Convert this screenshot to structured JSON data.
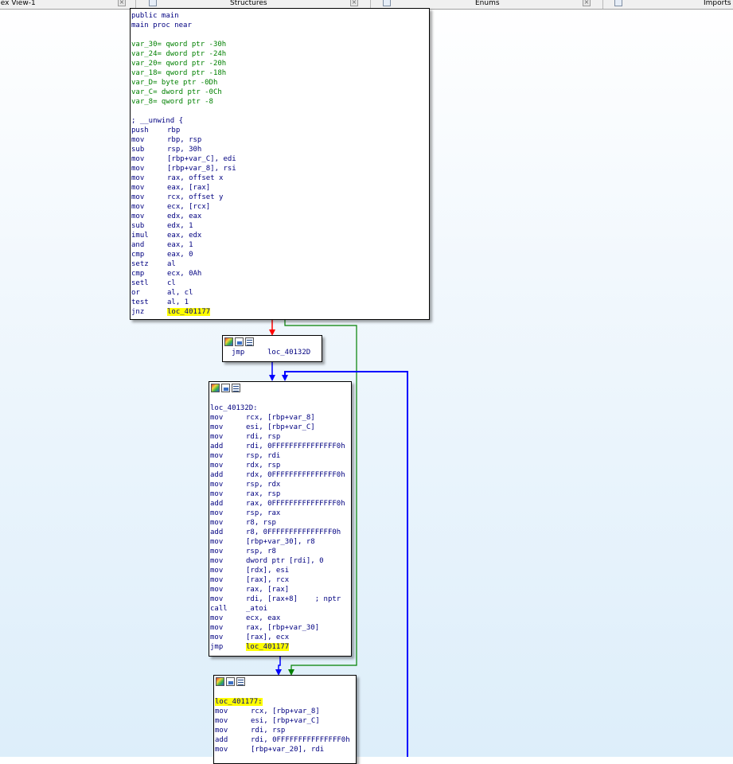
{
  "tabs": [
    {
      "label": "Hex View-1"
    },
    {
      "label": "Structures"
    },
    {
      "label": "Enums"
    },
    {
      "label": "Imports"
    }
  ],
  "colors": {
    "edge_true": "#008000",
    "edge_false": "#ff0000",
    "edge_uncond": "#0000ff",
    "highlight": "#ffff00"
  },
  "header_icons": [
    "graph-overview-icon",
    "edit-node-icon",
    "node-menu-icon"
  ],
  "node_main": {
    "lines": [
      {
        "t": "public main"
      },
      {
        "t": "main proc near"
      },
      {
        "t": ""
      },
      {
        "t": "var_30= qword ptr -30h",
        "c": "var"
      },
      {
        "t": "var_24= dword ptr -24h",
        "c": "var"
      },
      {
        "t": "var_20= qword ptr -20h",
        "c": "var"
      },
      {
        "t": "var_18= qword ptr -18h",
        "c": "var"
      },
      {
        "t": "var_D= byte ptr -0Dh",
        "c": "var"
      },
      {
        "t": "var_C= dword ptr -0Ch",
        "c": "var"
      },
      {
        "t": "var_8= qword ptr -8",
        "c": "var"
      },
      {
        "t": ""
      },
      {
        "t": "; __unwind {"
      },
      {
        "m": "push",
        "o": "rbp"
      },
      {
        "m": "mov",
        "o": "rbp, rsp"
      },
      {
        "m": "sub",
        "o": "rsp, 30h"
      },
      {
        "m": "mov",
        "o": "[rbp+var_C], edi"
      },
      {
        "m": "mov",
        "o": "[rbp+var_8], rsi"
      },
      {
        "m": "mov",
        "o": "rax, offset x"
      },
      {
        "m": "mov",
        "o": "eax, [rax]"
      },
      {
        "m": "mov",
        "o": "rcx, offset y"
      },
      {
        "m": "mov",
        "o": "ecx, [rcx]"
      },
      {
        "m": "mov",
        "o": "edx, eax"
      },
      {
        "m": "sub",
        "o": "edx, 1"
      },
      {
        "m": "imul",
        "o": "eax, edx"
      },
      {
        "m": "and",
        "o": "eax, 1"
      },
      {
        "m": "cmp",
        "o": "eax, 0"
      },
      {
        "m": "setz",
        "o": "al"
      },
      {
        "m": "cmp",
        "o": "ecx, 0Ah"
      },
      {
        "m": "setl",
        "o": "cl"
      },
      {
        "m": "or",
        "o": "al, cl"
      },
      {
        "m": "test",
        "o": "al, 1"
      },
      {
        "m": "jnz",
        "o": "loc_401177",
        "hl": true
      }
    ]
  },
  "node_jmp": {
    "lines": [
      {
        "m": "jmp",
        "o": "loc_40132D"
      }
    ]
  },
  "node_40132D": {
    "lines": [
      {
        "t": ""
      },
      {
        "t": "loc_40132D:"
      },
      {
        "m": "mov",
        "o": "rcx, [rbp+var_8]"
      },
      {
        "m": "mov",
        "o": "esi, [rbp+var_C]"
      },
      {
        "m": "mov",
        "o": "rdi, rsp"
      },
      {
        "m": "add",
        "o": "rdi, 0FFFFFFFFFFFFFFF0h"
      },
      {
        "m": "mov",
        "o": "rsp, rdi"
      },
      {
        "m": "mov",
        "o": "rdx, rsp"
      },
      {
        "m": "add",
        "o": "rdx, 0FFFFFFFFFFFFFFF0h"
      },
      {
        "m": "mov",
        "o": "rsp, rdx"
      },
      {
        "m": "mov",
        "o": "rax, rsp"
      },
      {
        "m": "add",
        "o": "rax, 0FFFFFFFFFFFFFFF0h"
      },
      {
        "m": "mov",
        "o": "rsp, rax"
      },
      {
        "m": "mov",
        "o": "r8, rsp"
      },
      {
        "m": "add",
        "o": "r8, 0FFFFFFFFFFFFFFF0h"
      },
      {
        "m": "mov",
        "o": "[rbp+var_30], r8"
      },
      {
        "m": "mov",
        "o": "rsp, r8"
      },
      {
        "m": "mov",
        "o": "dword ptr [rdi], 0"
      },
      {
        "m": "mov",
        "o": "[rdx], esi"
      },
      {
        "m": "mov",
        "o": "[rax], rcx"
      },
      {
        "m": "mov",
        "o": "rax, [rax]"
      },
      {
        "m": "mov",
        "o": "rdi, [rax+8]    ; nptr"
      },
      {
        "m": "call",
        "o": "_atoi"
      },
      {
        "m": "mov",
        "o": "ecx, eax"
      },
      {
        "m": "mov",
        "o": "rax, [rbp+var_30]"
      },
      {
        "m": "mov",
        "o": "[rax], ecx"
      },
      {
        "m": "jmp",
        "o": "loc_401177",
        "hl": true
      }
    ]
  },
  "node_401177": {
    "lines": [
      {
        "t": ""
      },
      {
        "t": "loc_401177:",
        "hl": true
      },
      {
        "m": "mov",
        "o": "rcx, [rbp+var_8]"
      },
      {
        "m": "mov",
        "o": "esi, [rbp+var_C]"
      },
      {
        "m": "mov",
        "o": "rdi, rsp"
      },
      {
        "m": "add",
        "o": "rdi, 0FFFFFFFFFFFFFFF0h"
      },
      {
        "m": "mov",
        "o": "[rbp+var_20], rdi"
      }
    ]
  }
}
